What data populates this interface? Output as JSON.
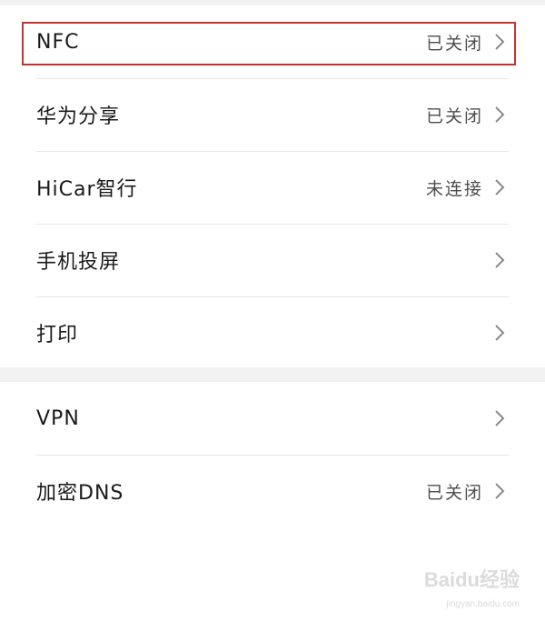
{
  "group1": {
    "items": [
      {
        "label": "NFC",
        "status": "已关闭"
      },
      {
        "label": "华为分享",
        "status": "已关闭"
      },
      {
        "label": "HiCar智行",
        "status": "未连接"
      },
      {
        "label": "手机投屏",
        "status": ""
      },
      {
        "label": "打印",
        "status": ""
      }
    ]
  },
  "group2": {
    "items": [
      {
        "label": "VPN",
        "status": ""
      },
      {
        "label": "加密DNS",
        "status": "已关闭"
      }
    ]
  },
  "watermark": {
    "logo": "Baidu经验",
    "url": "jingyan.baidu.com"
  },
  "colors": {
    "highlight": "#c8342d",
    "divider": "#e6e6e6",
    "group_gap": "#f2f2f2"
  }
}
